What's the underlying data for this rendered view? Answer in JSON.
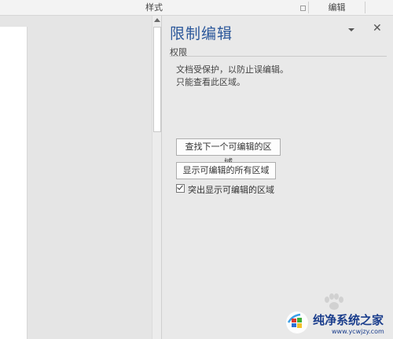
{
  "ribbon": {
    "styles_group_label": "样式",
    "edit_group_label": "编辑"
  },
  "pane": {
    "title": "限制编辑",
    "section_label": "权限",
    "description_lines": [
      "文档受保护，以防止误编辑。",
      "只能查看此区域。"
    ],
    "find_next_button": "查找下一个可编辑的区域",
    "show_all_button": "显示可编辑的所有区域",
    "highlight_checkbox_label": "突出显示可编辑的区域",
    "highlight_checked": true,
    "close_glyph": "✕"
  },
  "watermark": {
    "name": "纯净系统之家",
    "url": "www.ycwjzy.com"
  }
}
